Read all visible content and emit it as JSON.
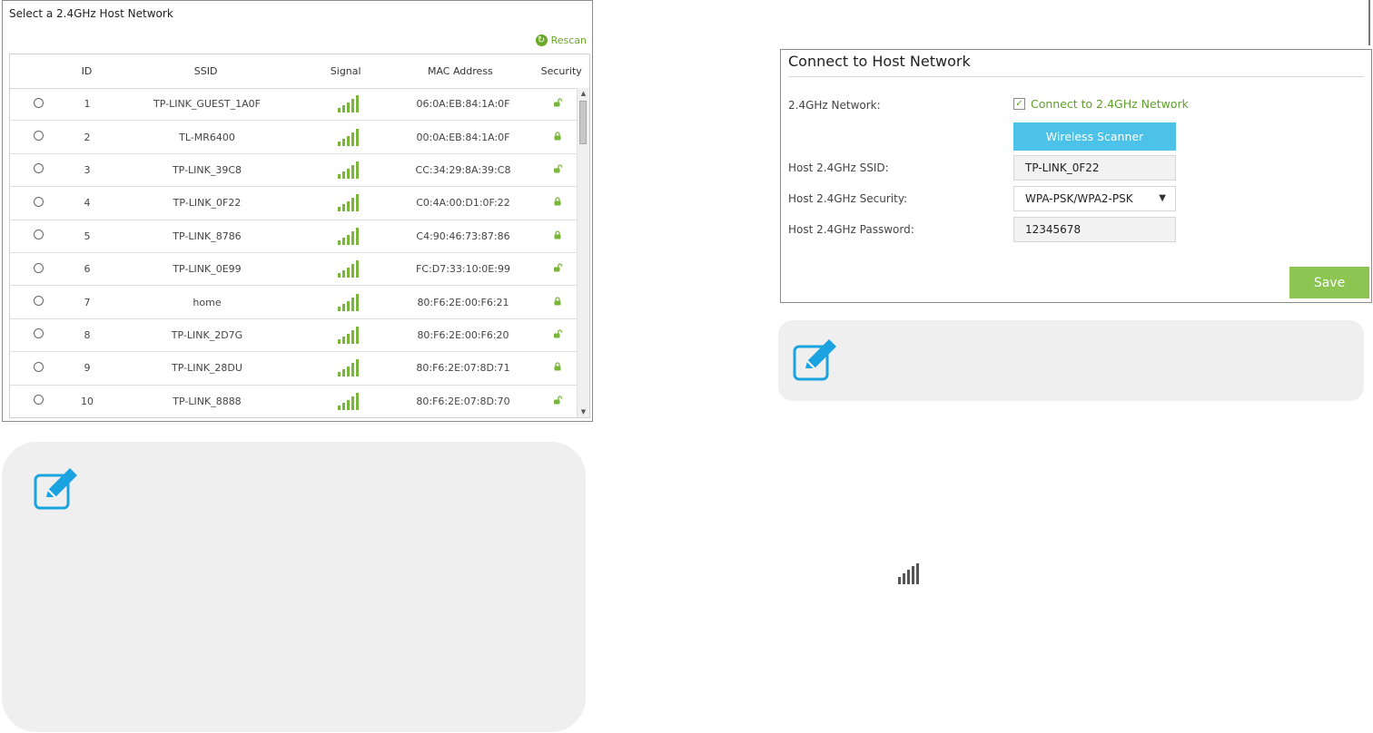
{
  "scan": {
    "title": "Select a 2.4GHz Host Network",
    "rescan_label": "Rescan",
    "columns": [
      "ID",
      "SSID",
      "Signal",
      "MAC Address",
      "Security"
    ],
    "rows": [
      {
        "id": "1",
        "ssid": "TP-LINK_GUEST_1A0F",
        "mac": "06:0A:EB:84:1A:0F",
        "security": "open"
      },
      {
        "id": "2",
        "ssid": "TL-MR6400",
        "mac": "00:0A:EB:84:1A:0F",
        "security": "locked"
      },
      {
        "id": "3",
        "ssid": "TP-LINK_39C8",
        "mac": "CC:34:29:8A:39:C8",
        "security": "open"
      },
      {
        "id": "4",
        "ssid": "TP-LINK_0F22",
        "mac": "C0:4A:00:D1:0F:22",
        "security": "locked"
      },
      {
        "id": "5",
        "ssid": "TP-LINK_8786",
        "mac": "C4:90:46:73:87:86",
        "security": "locked"
      },
      {
        "id": "6",
        "ssid": "TP-LINK_0E99",
        "mac": "FC:D7:33:10:0E:99",
        "security": "open"
      },
      {
        "id": "7",
        "ssid": "home",
        "mac": "80:F6:2E:00:F6:21",
        "security": "locked"
      },
      {
        "id": "8",
        "ssid": "TP-LINK_2D7G",
        "mac": "80:F6:2E:00:F6:20",
        "security": "open"
      },
      {
        "id": "9",
        "ssid": "TP-LINK_28DU",
        "mac": "80:F6:2E:07:8D:71",
        "security": "locked"
      },
      {
        "id": "10",
        "ssid": "TP-LINK_8888",
        "mac": "80:F6:2E:07:8D:70",
        "security": "open"
      }
    ]
  },
  "connect": {
    "title": "Connect to Host Network",
    "network_label": "2.4GHz Network:",
    "checkbox_label": "Connect to 2.4GHz Network",
    "checkbox_checked": true,
    "scanner_button": "Wireless Scanner",
    "ssid_label": "Host 2.4GHz SSID:",
    "ssid_value": "TP-LINK_0F22",
    "security_label": "Host 2.4GHz Security:",
    "security_value": "WPA-PSK/WPA2-PSK",
    "password_label": "Host 2.4GHz Password:",
    "password_value": "12345678",
    "save_button": "Save"
  },
  "colors": {
    "accent_green": "#79b63a",
    "scanner_blue": "#4dc2e8",
    "save_green": "#8cc552",
    "note_icon_blue": "#1aa3e0"
  },
  "icons": {
    "note": "edit-note-icon",
    "signal": "signal-strength-icon",
    "open": "unlocked-padlock-icon",
    "locked": "locked-padlock-icon",
    "rescan": "refresh-icon"
  }
}
